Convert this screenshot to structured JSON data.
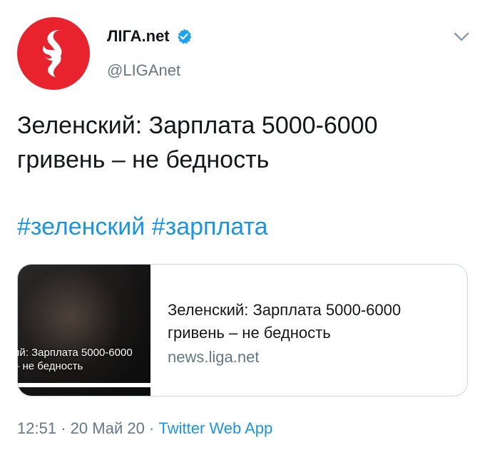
{
  "author": {
    "name": "ЛІГА.net",
    "handle": "@LIGAnet",
    "avatar_icon": "liga-logo-icon",
    "verified_icon": "verified-badge-icon"
  },
  "tweet": {
    "text": "Зеленский: Зарплата 5000-6000 гривень – не бедность",
    "hashtags": [
      "#зеленский",
      "#зарплата"
    ]
  },
  "card": {
    "thumb_overlay_line1": "ий: Зарплата 5000-6000",
    "thumb_overlay_line2": "– не бедность",
    "title": "Зеленский: Зарплата 5000-6000 гривень – не бедность",
    "domain": "news.liga.net"
  },
  "footer": {
    "time": "12:51",
    "separator": "·",
    "date": "20 Май 20",
    "source": "Twitter Web App"
  },
  "colors": {
    "brand_red": "#e8232d",
    "link_blue": "#1b95e0",
    "muted_gray": "#657786",
    "border": "#ccd6dd"
  }
}
